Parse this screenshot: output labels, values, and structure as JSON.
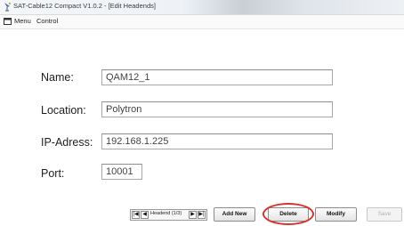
{
  "window": {
    "title": "SAT-Cable12 Compact V1.0.2 - [Edit Headends]",
    "icon": "satellite-app-icon"
  },
  "menu": {
    "items": [
      "Menu",
      "Control"
    ]
  },
  "form": {
    "name_label": "Name:",
    "name_value": "QAM12_1",
    "location_label": "Location:",
    "location_value": "Polytron",
    "ip_label": "IP-Adress:",
    "ip_value": "192.168.1.225",
    "port_label": "Port:",
    "port_value": "10001"
  },
  "navigator": {
    "text": "Headend (1/3)",
    "first": "|◀",
    "prev": "◀",
    "next": "▶",
    "last": "▶|"
  },
  "buttons": {
    "add_new": "Add New",
    "delete": "Delete",
    "modify": "Modify",
    "save": "Save"
  },
  "colors": {
    "highlight": "#d8322e"
  }
}
